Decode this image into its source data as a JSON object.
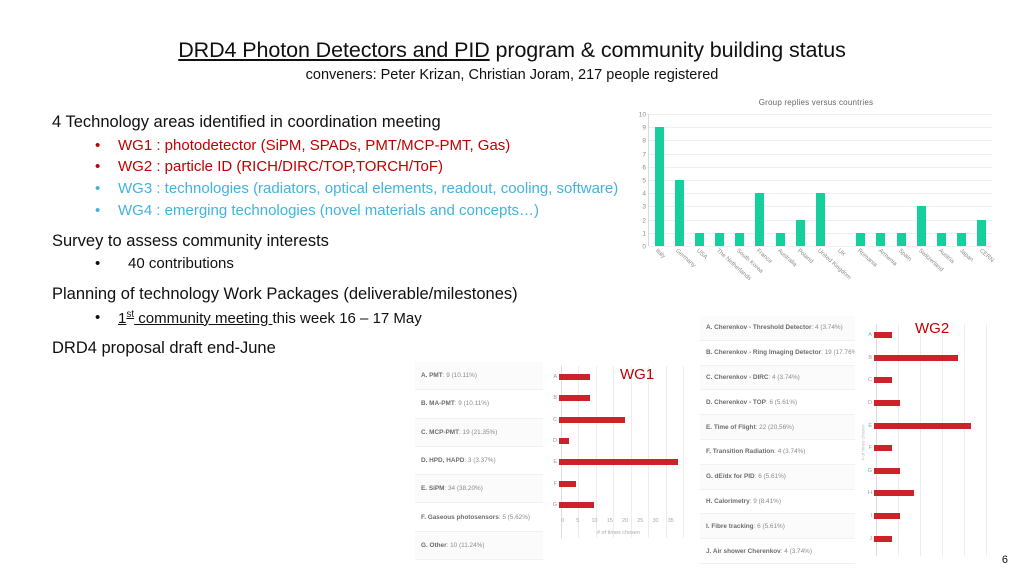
{
  "slide": {
    "title_underlined": "DRD4 Photon Detectors and PID",
    "title_rest": " program & community building status",
    "subtitle": "conveners: Peter Krizan, Christian Joram, 217 people registered",
    "number": "6"
  },
  "body": {
    "line1": "4 Technology areas identified in coordination meeting",
    "wg_bullets": [
      {
        "text": "WG1 : photodetector (SiPM, SPADs, PMT/MCP-PMT, Gas)",
        "color": "red"
      },
      {
        "text": "WG2 : particle ID (RICH/DIRC/TOP,TORCH/ToF)",
        "color": "red"
      },
      {
        "text": "WG3 : technologies (radiators, optical elements,  readout, cooling, software)",
        "color": "blue"
      },
      {
        "text": "WG4 : emerging technologies (novel materials and concepts…)",
        "color": "blue"
      }
    ],
    "line2": "Survey to assess community interests",
    "bullet2": "40 contributions",
    "line3": "Planning of technology Work Packages (deliverable/milestones)",
    "bullet3_underlined_a": "1",
    "bullet3_sup": "st",
    "bullet3_underlined_b": " community meeting ",
    "bullet3_rest": "this week 16 – 17 May",
    "line4": "DRD4 proposal draft end-June"
  },
  "colors": {
    "red_bullet": "#c00000",
    "blue_bullet": "#41b3e0",
    "green_bar": "#17cf9d",
    "red_bar": "#cc2229"
  },
  "chart_data": [
    {
      "id": "group-replies",
      "type": "bar",
      "title": "Group replies versus countries",
      "xlabel": "",
      "ylabel": "",
      "ylim": [
        0,
        10
      ],
      "yticks": [
        0,
        1,
        2,
        3,
        4,
        5,
        6,
        7,
        8,
        9,
        10
      ],
      "grid": true,
      "legend": "none",
      "categories": [
        "Italy",
        "Germany",
        "USA",
        "The Netherlands",
        "South Korea",
        "France",
        "Australia",
        "Poland",
        "United Kingdom",
        "UK",
        "Romania",
        "Armenia",
        "Spain",
        "Switzerland",
        "Austria",
        "Japan",
        "CERN"
      ],
      "values": [
        9,
        5,
        1,
        1,
        1,
        4,
        1,
        2,
        4,
        0,
        1,
        1,
        1,
        3,
        1,
        1,
        2
      ],
      "color": "#17cf9d"
    },
    {
      "id": "wg1-photodetectors",
      "type": "bar",
      "orientation": "horizontal",
      "title": "WG1",
      "xlabel": "# of times chosen",
      "ylabel": "",
      "xlim": [
        0,
        35
      ],
      "xticks": [
        0,
        5,
        10,
        15,
        20,
        25,
        30,
        35
      ],
      "grid": true,
      "color": "#cc2229",
      "categories": [
        "A",
        "B",
        "C",
        "D",
        "E",
        "F",
        "G"
      ],
      "values": [
        9,
        9,
        19,
        3,
        34,
        5,
        10
      ],
      "legend_entries": [
        {
          "key": "A.",
          "label": "PMT",
          "value": "9 (10.11%)"
        },
        {
          "key": "B.",
          "label": "MA-PMT",
          "value": "9 (10.11%)"
        },
        {
          "key": "C.",
          "label": "MCP-PMT",
          "value": "19 (21.35%)"
        },
        {
          "key": "D.",
          "label": "HPD, HAPD",
          "value": "3 (3.37%)"
        },
        {
          "key": "E.",
          "label": "SiPM",
          "value": "34 (38.20%)"
        },
        {
          "key": "F.",
          "label": "Gaseous photosensors",
          "value": "5 (5.62%)"
        },
        {
          "key": "G.",
          "label": "Other",
          "value": "10 (11.24%)"
        }
      ]
    },
    {
      "id": "wg2-particle-id",
      "type": "bar",
      "orientation": "horizontal",
      "title": "WG2",
      "xlabel": "",
      "ylabel": "# of times chosen",
      "xlim": [
        0,
        25
      ],
      "xticks": [
        0,
        5,
        10,
        15,
        20,
        25
      ],
      "grid": true,
      "color": "#cc2229",
      "categories": [
        "A",
        "B",
        "C",
        "D",
        "E",
        "F",
        "G",
        "H",
        "I",
        "J"
      ],
      "values": [
        4,
        19,
        4,
        6,
        22,
        4,
        6,
        9,
        6,
        4
      ],
      "legend_entries": [
        {
          "key": "A.",
          "label": "Cherenkov - Threshold Detector",
          "value": "4 (3.74%)"
        },
        {
          "key": "B.",
          "label": "Cherenkov - Ring Imaging Detector",
          "value": "19 (17.76%)"
        },
        {
          "key": "C.",
          "label": "Cherenkov - DIRC",
          "value": "4 (3.74%)"
        },
        {
          "key": "D.",
          "label": "Cherenkov - TOP",
          "value": "6 (5.61%)"
        },
        {
          "key": "E.",
          "label": "Time of Flight",
          "value": "22 (20.56%)"
        },
        {
          "key": "F.",
          "label": "Transition Radiation",
          "value": "4 (3.74%)"
        },
        {
          "key": "G.",
          "label": "dE/dx for PID",
          "value": "6 (5.61%)"
        },
        {
          "key": "H.",
          "label": "Calorimetry",
          "value": "9 (8.41%)"
        },
        {
          "key": "I.",
          "label": "Fibre tracking",
          "value": "6 (5.61%)"
        },
        {
          "key": "J.",
          "label": "Air shower Cherenkov",
          "value": "4 (3.74%)"
        }
      ]
    }
  ]
}
